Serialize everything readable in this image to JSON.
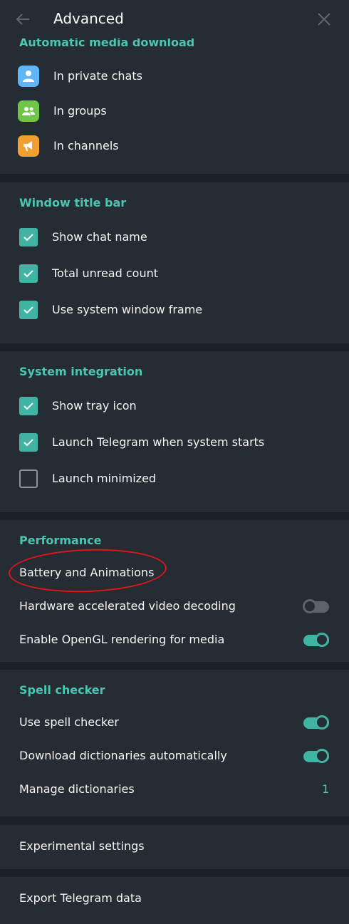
{
  "header": {
    "title": "Advanced",
    "back_icon": "arrow-left-icon",
    "close_icon": "close-icon"
  },
  "media": {
    "title": "Automatic media download",
    "items": [
      {
        "label": "In private chats",
        "icon": "person-icon",
        "color": "#5eb5f7"
      },
      {
        "label": "In groups",
        "icon": "group-icon",
        "color": "#6fc548"
      },
      {
        "label": "In channels",
        "icon": "megaphone-icon",
        "color": "#f0a030"
      }
    ]
  },
  "window_title_bar": {
    "title": "Window title bar",
    "items": [
      {
        "label": "Show chat name",
        "checked": true
      },
      {
        "label": "Total unread count",
        "checked": true
      },
      {
        "label": "Use system window frame",
        "checked": true
      }
    ]
  },
  "system_integration": {
    "title": "System integration",
    "items": [
      {
        "label": "Show tray icon",
        "checked": true
      },
      {
        "label": "Launch Telegram when system starts",
        "checked": true
      },
      {
        "label": "Launch minimized",
        "checked": false
      }
    ]
  },
  "performance": {
    "title": "Performance",
    "battery": "Battery and Animations",
    "hw_video": {
      "label": "Hardware accelerated video decoding",
      "enabled": false
    },
    "opengl": {
      "label": "Enable OpenGL rendering for media",
      "enabled": true
    }
  },
  "spell_checker": {
    "title": "Spell checker",
    "use": {
      "label": "Use spell checker",
      "enabled": true
    },
    "download": {
      "label": "Download dictionaries automatically",
      "enabled": true
    },
    "manage": {
      "label": "Manage dictionaries",
      "count": "1"
    }
  },
  "experimental": {
    "label": "Experimental settings"
  },
  "export": {
    "label": "Export Telegram data"
  },
  "colors": {
    "accent": "#4bc6b1",
    "checkbox": "#40b3a2",
    "panel": "#262c33",
    "divider": "#1b2026"
  }
}
